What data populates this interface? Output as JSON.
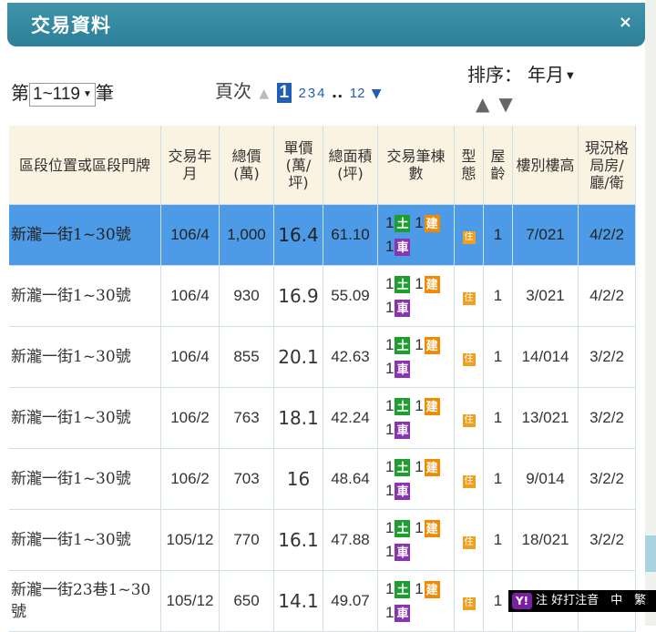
{
  "header": {
    "title": "交易資料",
    "close": "×"
  },
  "pager": {
    "prefix": "第",
    "range": "1~119",
    "suffix": "筆",
    "page_label": "頁次",
    "current_page": "1",
    "pages": [
      "2",
      "3",
      "4"
    ],
    "ellipsis": "..",
    "last_page": "12"
  },
  "sort": {
    "label": "排序：",
    "selected": "年月"
  },
  "table": {
    "headers": [
      "區段位置或區段門牌",
      "交易年月",
      "總價(萬)",
      "單價(萬/坪)",
      "總面積(坪)",
      "交易筆棟數",
      "型態",
      "屋齡",
      "樓別樓高",
      "現況格局房/廳/衛"
    ],
    "rows": [
      {
        "addr": "新瀧一街1~30號",
        "ym": "106/4",
        "total": "1,000",
        "unit": "16.4",
        "area": "61.10",
        "age": "1",
        "floor": "7/021",
        "layout": "4/2/2"
      },
      {
        "addr": "新瀧一街1~30號",
        "ym": "106/4",
        "total": "930",
        "unit": "16.9",
        "area": "55.09",
        "age": "1",
        "floor": "3/021",
        "layout": "4/2/2"
      },
      {
        "addr": "新瀧一街1~30號",
        "ym": "106/4",
        "total": "855",
        "unit": "20.1",
        "area": "42.63",
        "age": "1",
        "floor": "14/014",
        "layout": "3/2/2"
      },
      {
        "addr": "新瀧一街1~30號",
        "ym": "106/2",
        "total": "763",
        "unit": "18.1",
        "area": "42.24",
        "age": "1",
        "floor": "13/021",
        "layout": "3/2/2"
      },
      {
        "addr": "新瀧一街1~30號",
        "ym": "106/2",
        "total": "703",
        "unit": "16",
        "area": "48.64",
        "age": "1",
        "floor": "9/014",
        "layout": "3/2/2"
      },
      {
        "addr": "新瀧一街1~30號",
        "ym": "105/12",
        "total": "770",
        "unit": "16.1",
        "area": "47.88",
        "age": "1",
        "floor": "18/021",
        "layout": "3/2/2"
      },
      {
        "addr": "新瀧一街23巷1~30號",
        "ym": "105/12",
        "total": "650",
        "unit": "14.1",
        "area": "49.07",
        "age": "1",
        "floor": "",
        "layout": ""
      }
    ],
    "txn": {
      "n": "1",
      "land": "土",
      "building": "建",
      "car": "車"
    },
    "type_badge": "住"
  },
  "ime": {
    "logo": "Y!",
    "text": "注 好打注音　中　繁"
  },
  "colors": {
    "header": "#2c7f98",
    "highlight_row": "#4d9be6",
    "page_current": "#1f5fb7",
    "th_bg": "#fbf3e2"
  }
}
